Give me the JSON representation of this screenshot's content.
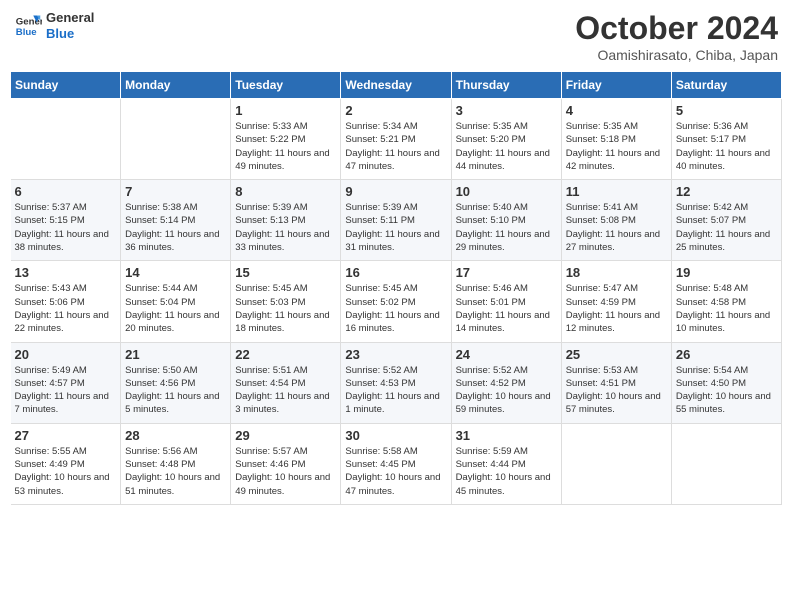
{
  "header": {
    "logo_text_general": "General",
    "logo_text_blue": "Blue",
    "month": "October 2024",
    "location": "Oamishirasato, Chiba, Japan"
  },
  "weekdays": [
    "Sunday",
    "Monday",
    "Tuesday",
    "Wednesday",
    "Thursday",
    "Friday",
    "Saturday"
  ],
  "weeks": [
    [
      {
        "day": "",
        "content": ""
      },
      {
        "day": "",
        "content": ""
      },
      {
        "day": "1",
        "content": "Sunrise: 5:33 AM\nSunset: 5:22 PM\nDaylight: 11 hours\nand 49 minutes."
      },
      {
        "day": "2",
        "content": "Sunrise: 5:34 AM\nSunset: 5:21 PM\nDaylight: 11 hours\nand 47 minutes."
      },
      {
        "day": "3",
        "content": "Sunrise: 5:35 AM\nSunset: 5:20 PM\nDaylight: 11 hours\nand 44 minutes."
      },
      {
        "day": "4",
        "content": "Sunrise: 5:35 AM\nSunset: 5:18 PM\nDaylight: 11 hours\nand 42 minutes."
      },
      {
        "day": "5",
        "content": "Sunrise: 5:36 AM\nSunset: 5:17 PM\nDaylight: 11 hours\nand 40 minutes."
      }
    ],
    [
      {
        "day": "6",
        "content": "Sunrise: 5:37 AM\nSunset: 5:15 PM\nDaylight: 11 hours\nand 38 minutes."
      },
      {
        "day": "7",
        "content": "Sunrise: 5:38 AM\nSunset: 5:14 PM\nDaylight: 11 hours\nand 36 minutes."
      },
      {
        "day": "8",
        "content": "Sunrise: 5:39 AM\nSunset: 5:13 PM\nDaylight: 11 hours\nand 33 minutes."
      },
      {
        "day": "9",
        "content": "Sunrise: 5:39 AM\nSunset: 5:11 PM\nDaylight: 11 hours\nand 31 minutes."
      },
      {
        "day": "10",
        "content": "Sunrise: 5:40 AM\nSunset: 5:10 PM\nDaylight: 11 hours\nand 29 minutes."
      },
      {
        "day": "11",
        "content": "Sunrise: 5:41 AM\nSunset: 5:08 PM\nDaylight: 11 hours\nand 27 minutes."
      },
      {
        "day": "12",
        "content": "Sunrise: 5:42 AM\nSunset: 5:07 PM\nDaylight: 11 hours\nand 25 minutes."
      }
    ],
    [
      {
        "day": "13",
        "content": "Sunrise: 5:43 AM\nSunset: 5:06 PM\nDaylight: 11 hours\nand 22 minutes."
      },
      {
        "day": "14",
        "content": "Sunrise: 5:44 AM\nSunset: 5:04 PM\nDaylight: 11 hours\nand 20 minutes."
      },
      {
        "day": "15",
        "content": "Sunrise: 5:45 AM\nSunset: 5:03 PM\nDaylight: 11 hours\nand 18 minutes."
      },
      {
        "day": "16",
        "content": "Sunrise: 5:45 AM\nSunset: 5:02 PM\nDaylight: 11 hours\nand 16 minutes."
      },
      {
        "day": "17",
        "content": "Sunrise: 5:46 AM\nSunset: 5:01 PM\nDaylight: 11 hours\nand 14 minutes."
      },
      {
        "day": "18",
        "content": "Sunrise: 5:47 AM\nSunset: 4:59 PM\nDaylight: 11 hours\nand 12 minutes."
      },
      {
        "day": "19",
        "content": "Sunrise: 5:48 AM\nSunset: 4:58 PM\nDaylight: 11 hours\nand 10 minutes."
      }
    ],
    [
      {
        "day": "20",
        "content": "Sunrise: 5:49 AM\nSunset: 4:57 PM\nDaylight: 11 hours\nand 7 minutes."
      },
      {
        "day": "21",
        "content": "Sunrise: 5:50 AM\nSunset: 4:56 PM\nDaylight: 11 hours\nand 5 minutes."
      },
      {
        "day": "22",
        "content": "Sunrise: 5:51 AM\nSunset: 4:54 PM\nDaylight: 11 hours\nand 3 minutes."
      },
      {
        "day": "23",
        "content": "Sunrise: 5:52 AM\nSunset: 4:53 PM\nDaylight: 11 hours\nand 1 minute."
      },
      {
        "day": "24",
        "content": "Sunrise: 5:52 AM\nSunset: 4:52 PM\nDaylight: 10 hours\nand 59 minutes."
      },
      {
        "day": "25",
        "content": "Sunrise: 5:53 AM\nSunset: 4:51 PM\nDaylight: 10 hours\nand 57 minutes."
      },
      {
        "day": "26",
        "content": "Sunrise: 5:54 AM\nSunset: 4:50 PM\nDaylight: 10 hours\nand 55 minutes."
      }
    ],
    [
      {
        "day": "27",
        "content": "Sunrise: 5:55 AM\nSunset: 4:49 PM\nDaylight: 10 hours\nand 53 minutes."
      },
      {
        "day": "28",
        "content": "Sunrise: 5:56 AM\nSunset: 4:48 PM\nDaylight: 10 hours\nand 51 minutes."
      },
      {
        "day": "29",
        "content": "Sunrise: 5:57 AM\nSunset: 4:46 PM\nDaylight: 10 hours\nand 49 minutes."
      },
      {
        "day": "30",
        "content": "Sunrise: 5:58 AM\nSunset: 4:45 PM\nDaylight: 10 hours\nand 47 minutes."
      },
      {
        "day": "31",
        "content": "Sunrise: 5:59 AM\nSunset: 4:44 PM\nDaylight: 10 hours\nand 45 minutes."
      },
      {
        "day": "",
        "content": ""
      },
      {
        "day": "",
        "content": ""
      }
    ]
  ]
}
